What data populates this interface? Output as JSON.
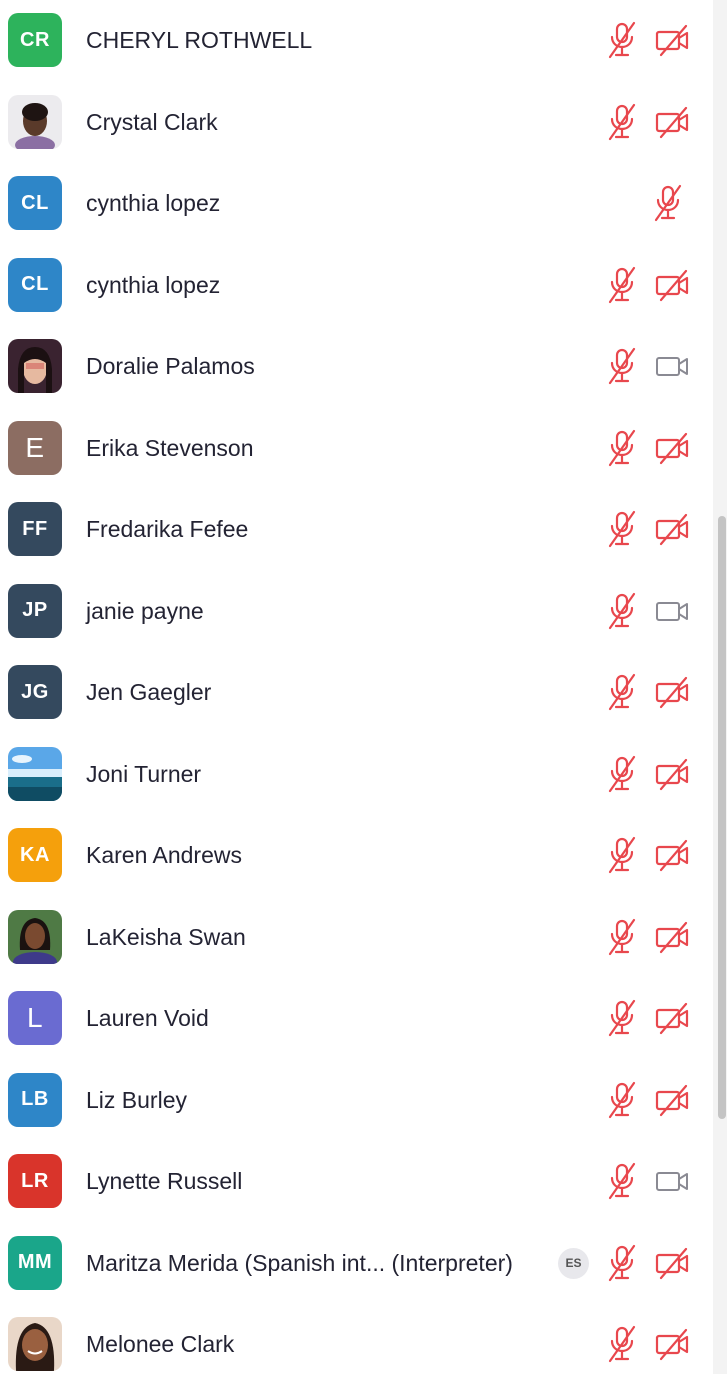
{
  "participants": [
    {
      "name": "CHERYL ROTHWELL",
      "initials": "CR",
      "avatar_color": "#2db35c",
      "mic": "muted",
      "camera": "off"
    },
    {
      "name": "Crystal Clark",
      "initials": "",
      "avatar_photo": "photo-1",
      "mic": "muted",
      "camera": "off"
    },
    {
      "name": "cynthia lopez",
      "initials": "CL",
      "avatar_color": "#2e86c8",
      "mic": "muted",
      "camera": "none"
    },
    {
      "name": "cynthia lopez",
      "initials": "CL",
      "avatar_color": "#2e86c8",
      "mic": "muted",
      "camera": "off"
    },
    {
      "name": "Doralie Palamos",
      "initials": "",
      "avatar_photo": "photo-2",
      "mic": "muted",
      "camera": "on"
    },
    {
      "name": "Erika Stevenson",
      "initials": "E",
      "avatar_color": "#8c6d62",
      "mic": "muted",
      "camera": "off"
    },
    {
      "name": "Fredarika Fefee",
      "initials": "FF",
      "avatar_color": "#34495e",
      "mic": "muted",
      "camera": "off"
    },
    {
      "name": "janie payne",
      "initials": "JP",
      "avatar_color": "#34495e",
      "mic": "muted",
      "camera": "on"
    },
    {
      "name": "Jen Gaegler",
      "initials": "JG",
      "avatar_color": "#34495e",
      "mic": "muted",
      "camera": "off"
    },
    {
      "name": "Joni Turner",
      "initials": "",
      "avatar_photo": "photo-3",
      "mic": "muted",
      "camera": "off"
    },
    {
      "name": "Karen Andrews",
      "initials": "KA",
      "avatar_color": "#f5a00c",
      "mic": "muted",
      "camera": "off"
    },
    {
      "name": "LaKeisha Swan",
      "initials": "",
      "avatar_photo": "photo-4",
      "mic": "muted",
      "camera": "off"
    },
    {
      "name": "Lauren Void",
      "initials": "L",
      "avatar_color": "#6a6bd1",
      "mic": "muted",
      "camera": "off"
    },
    {
      "name": "Liz Burley",
      "initials": "LB",
      "avatar_color": "#2e86c8",
      "mic": "muted",
      "camera": "off"
    },
    {
      "name": "Lynette Russell",
      "initials": "LR",
      "avatar_color": "#d9342b",
      "mic": "muted",
      "camera": "on"
    },
    {
      "name": "Maritza Merida (Spanish int... (Interpreter)",
      "initials": "MM",
      "avatar_color": "#1aa68a",
      "language_badge": "ES",
      "mic": "muted",
      "camera": "off"
    },
    {
      "name": "Melonee Clark",
      "initials": "",
      "avatar_photo": "photo-5",
      "mic": "muted",
      "camera": "off"
    }
  ],
  "colors": {
    "muted_red": "#e8474d",
    "camera_gray": "#8a8a93",
    "text": "#232333"
  }
}
